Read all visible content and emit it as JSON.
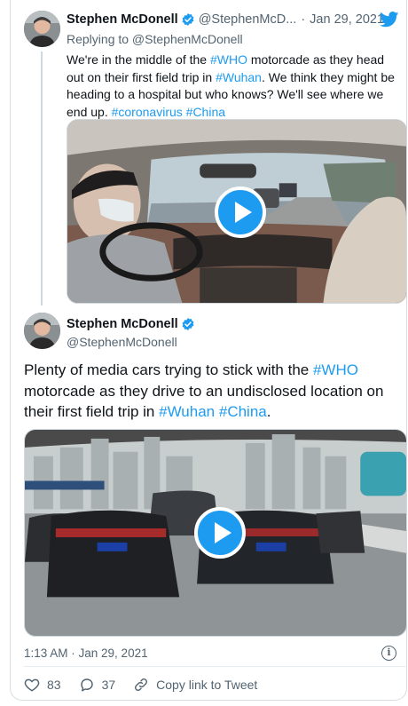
{
  "reply_tweet": {
    "author_name": "Stephen McDonell",
    "handle": "@StephenMcD...",
    "separator": "·",
    "date": "Jan 29, 2021",
    "replying_to": "Replying to @StephenMcDonell",
    "text_parts": [
      "We're in the middle of the ",
      "#WHO",
      " motorcade as they head out on their first field trip in ",
      "#Wuhan",
      ". We think they might be heading to a hospital but who knows? We'll see where we end up. ",
      "#coronavirus",
      " ",
      "#China"
    ]
  },
  "main_tweet": {
    "author_name": "Stephen McDonell",
    "handle": "@StephenMcDonell",
    "text_parts": [
      "Plenty of media cars trying to stick with the ",
      "#WHO",
      " motorcade as they drive to an undisclosed location on their first field trip in ",
      "#Wuhan",
      " ",
      "#China",
      "."
    ],
    "timestamp": "1:13 AM · Jan 29, 2021",
    "likes": "83",
    "replies": "37",
    "copy_link_label": "Copy link to Tweet"
  },
  "colors": {
    "accent": "#1d9bf0",
    "text": "#0f1419",
    "muted": "#536471",
    "like": "#536471"
  },
  "icons": {
    "verified": "verified-badge-icon",
    "brand": "twitter-bird-icon",
    "like": "heart-icon",
    "reply": "speech-bubble-icon",
    "link": "link-icon",
    "info": "info-icon",
    "play": "play-icon"
  }
}
